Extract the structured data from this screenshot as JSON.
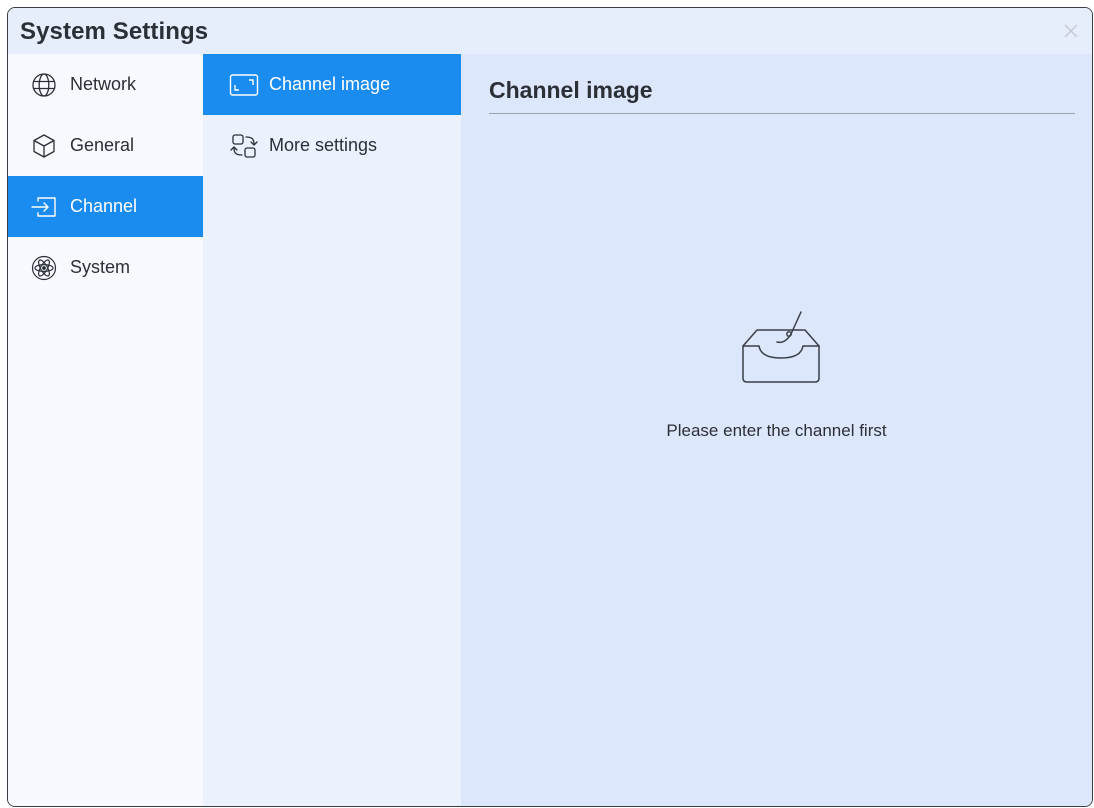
{
  "window": {
    "title": "System Settings",
    "close_icon": "close-icon"
  },
  "sidebar": {
    "items": [
      {
        "label": "Network",
        "icon": "globe-icon",
        "active": false
      },
      {
        "label": "General",
        "icon": "cube-icon",
        "active": false
      },
      {
        "label": "Channel",
        "icon": "input-arrow-icon",
        "active": true
      },
      {
        "label": "System",
        "icon": "atom-icon",
        "active": false
      }
    ]
  },
  "subnav": {
    "items": [
      {
        "label": "Channel image",
        "icon": "frame-corners-icon",
        "active": true
      },
      {
        "label": "More settings",
        "icon": "swap-boxes-icon",
        "active": false
      }
    ]
  },
  "content": {
    "title": "Channel image",
    "empty_state": {
      "icon": "empty-tray-icon",
      "message": "Please enter the channel first"
    }
  },
  "colors": {
    "accent": "#1a8cf0",
    "titlebar": "#e7eefb",
    "sidebar": "#f7f9ff",
    "subnav": "#ebf1fd",
    "content": "#dde7fb",
    "text": "#2b2f36"
  }
}
